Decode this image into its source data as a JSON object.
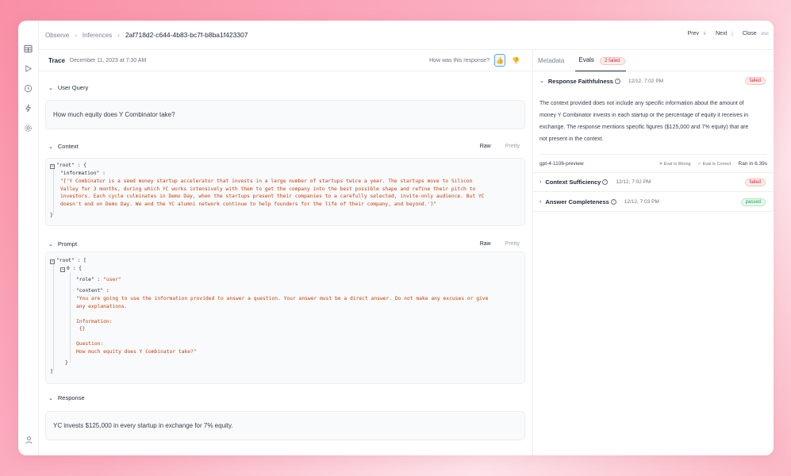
{
  "breadcrumb": {
    "root": "Observe",
    "section": "Inferences",
    "id": "2af718d2-c644-4b83-bc7f-b8ba1f423307"
  },
  "nav": {
    "prev_label": "Prev",
    "prev_key": "k",
    "next_label": "Next",
    "next_key": "j",
    "close_label": "Close",
    "close_key": "esc"
  },
  "trace": {
    "title": "Trace",
    "date": "December 11, 2023 at 7:30 AM",
    "feedback_prompt": "How was this response?"
  },
  "user_query": {
    "label": "User Query",
    "text": "How much equity does Y Combinator take?"
  },
  "context": {
    "label": "Context",
    "raw_label": "Raw",
    "pretty_label": "Pretty",
    "root_key": "\"root\"",
    "open_brace": "{",
    "close_brace": "}",
    "info_key": "\"information\"",
    "value_lines": [
      "\"['Y Combinator is a seed money startup accelerator that invests in a large number of startups twice a year. The startups move to Silicon",
      "Valley for 3 months, during which YC works intensively with them to get the company into the best possible shape and refine their pitch to",
      "investors. Each cycle culminates in Demo Day, when the startups present their companies to a carefully selected, invite-only audience. But YC",
      "doesn't end on Demo Day. We and the YC alumni network continue to help founders for the life of their company, and beyond.']\""
    ]
  },
  "prompt": {
    "label": "Prompt",
    "raw_label": "Raw",
    "pretty_label": "Pretty",
    "root_key": "\"root\"",
    "open_bracket": "[",
    "close_bracket": "]",
    "index_key": "0",
    "open_brace": "{",
    "close_brace": "}",
    "role_key": "\"role\"",
    "role_value": "\"user\"",
    "content_key": "\"content\"",
    "content_lines": [
      "\"You are going to use the information provided to answer a question. Your answer must be a direct answer. Do not make any excuses or give",
      "any explanations.",
      "",
      "Information:",
      " {}",
      "",
      "Question:",
      "How much equity does Y Combinator take?\""
    ]
  },
  "response": {
    "label": "Response",
    "text": "YC invests $125,000 in every startup in exchange for 7% equity."
  },
  "right_tabs": {
    "metadata": "Metadata",
    "evals": "Evals",
    "evals_badge": "2 failed"
  },
  "evals": [
    {
      "name": "Response Faithfulness",
      "time": "12/12, 7:02 PM",
      "status": "failed",
      "body": [
        "The context provided does not include any specific information about the amount of",
        "money Y Combinator invests in each startup or the percentage of equity it receives in",
        "exchange. The response mentions specific figures ($125,000 and 7% equity) that are",
        "not present in the context."
      ],
      "model": "gpt-4-1106-preview",
      "wrong_label": "Eval is Wrong",
      "correct_label": "Eval is Correct",
      "ran": "Ran in 6.39s"
    },
    {
      "name": "Context Sufficiency",
      "time": "12/12, 7:02 PM",
      "status": "failed"
    },
    {
      "name": "Answer Completeness",
      "time": "12/12, 7:03 PM",
      "status": "passed"
    }
  ],
  "colors": {
    "failed": "#dc2626",
    "passed": "#16a34a",
    "string": "#c2410c",
    "active_tab": "#1f2937"
  },
  "icons": [
    "table-icon",
    "play-icon",
    "history-icon",
    "bolt-icon",
    "settings-icon",
    "user-icon",
    "thumbs-up-icon",
    "thumbs-down-icon",
    "chevron-down-icon",
    "chevron-right-icon",
    "help-icon",
    "x-icon",
    "check-icon",
    "collapse-box-icon"
  ]
}
